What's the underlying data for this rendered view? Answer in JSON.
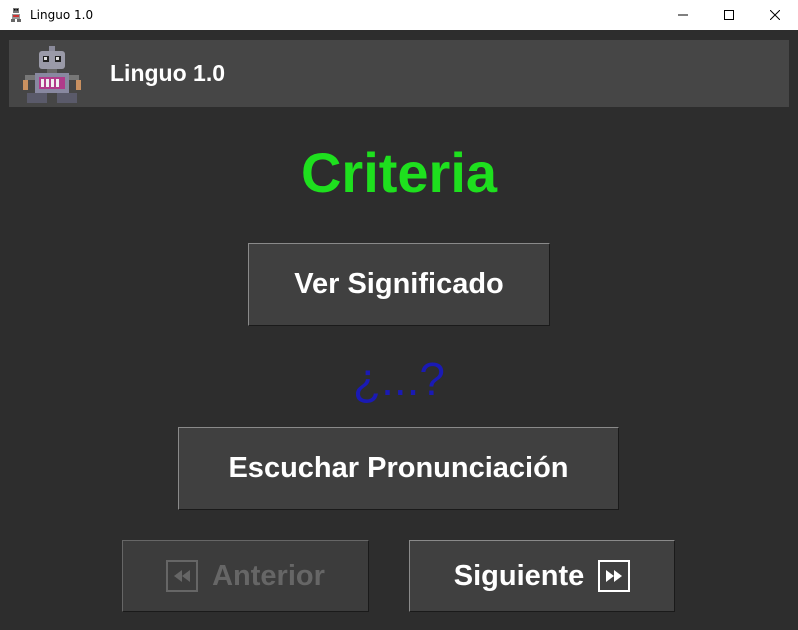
{
  "window": {
    "title": "Linguo 1.0",
    "controls": [
      "minimize-icon",
      "maximize-icon",
      "close-icon"
    ]
  },
  "header": {
    "title": "Linguo 1.0",
    "logo_icon": "robot-icon"
  },
  "word": {
    "text": "Criteria",
    "color": "#1ee01e"
  },
  "buttons": {
    "meaning_label": "Ver Significado",
    "listen_label": "Escuchar Pronunciación",
    "prev_label": "Anterior",
    "next_label": "Siguiente"
  },
  "meaning": {
    "text": "¿...?",
    "color": "#1a1ab4"
  }
}
